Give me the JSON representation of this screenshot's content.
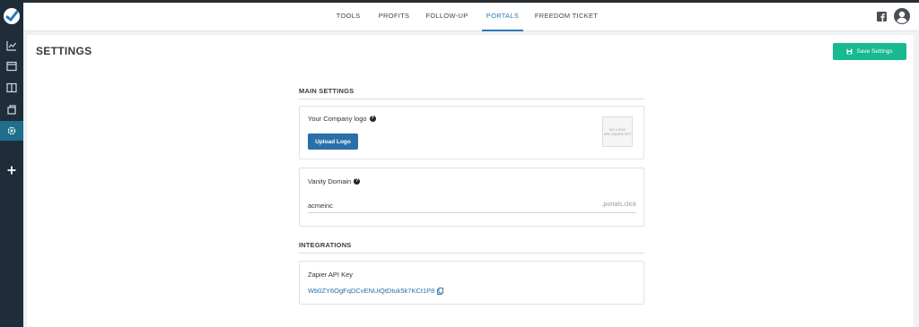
{
  "colors": {
    "sidebar_bg": "#1f2d3a",
    "sidebar_active": "#1d6f8c",
    "accent_blue": "#2a7ab8",
    "save_green": "#17b98e",
    "upload_blue": "#2a6fa8"
  },
  "nav": {
    "tabs": [
      {
        "label": "TOOLS"
      },
      {
        "label": "PROFITS"
      },
      {
        "label": "FOLLOW-UP"
      },
      {
        "label": "PORTALS",
        "active": true
      },
      {
        "label": "FREEDOM TICKET"
      }
    ]
  },
  "sidebar": {
    "icons": [
      "app-logo-icon",
      "chart-line-icon",
      "browser-window-icon",
      "columns-icon",
      "portals-icon",
      "gear-icon",
      "plus-icon"
    ],
    "active": "gear-icon"
  },
  "header": {
    "icons": [
      "facebook-icon",
      "user-avatar-icon"
    ]
  },
  "page": {
    "title": "SETTINGS",
    "save_label": "Save Settings"
  },
  "main_settings": {
    "heading": "MAIN SETTINGS",
    "logo_label": "Your Company logo",
    "upload_label": "Upload Logo",
    "logo_placeholder": "NO LOGO UPLOADED YET",
    "vanity_label": "Vanity Domain",
    "vanity_value": "acmeinc",
    "vanity_suffix": ".portals.click"
  },
  "integrations": {
    "heading": "INTEGRATIONS",
    "zapier_label": "Zapier API Key",
    "zapier_key": "Wb0ZY6OgFqDCvENUiQtDtuk5k7KCt1P8"
  }
}
